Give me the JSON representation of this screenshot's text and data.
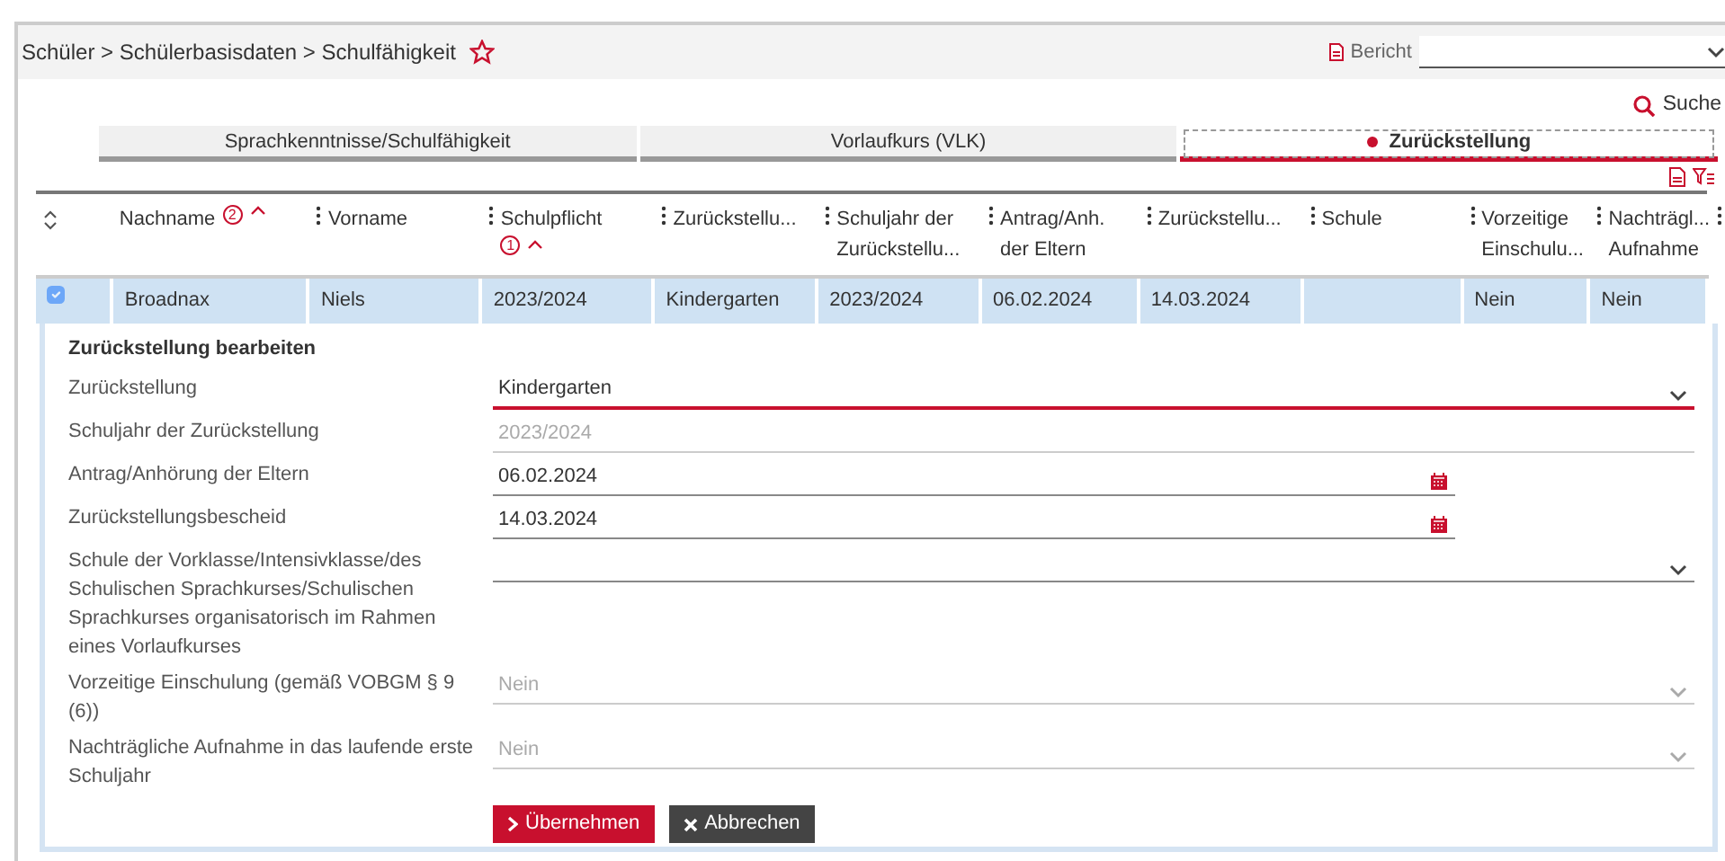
{
  "breadcrumb": {
    "path": "Schüler > Schülerbasisdaten > Schulfähigkeit"
  },
  "report": {
    "label": "Bericht"
  },
  "search": {
    "label": "Suche"
  },
  "tabs": [
    {
      "label": "Sprachkenntnisse/Schulfähigkeit",
      "selected": false
    },
    {
      "label": "Vorlaufkurs (VLK)",
      "selected": false
    },
    {
      "label": "Zurückstellung",
      "selected": true
    }
  ],
  "table": {
    "columns": [
      {
        "kind": "sort"
      },
      {
        "kind": "data",
        "label": "Nachname",
        "sort_rank": "2"
      },
      {
        "kind": "data",
        "label": "Vorname"
      },
      {
        "kind": "data",
        "label": "Schulpflicht",
        "sort_rank": "1"
      },
      {
        "kind": "data",
        "label": "Zurückstellu..."
      },
      {
        "kind": "data",
        "label": "Schuljahr der Zurückstellu..."
      },
      {
        "kind": "data",
        "label": "Antrag/Anh. der Eltern"
      },
      {
        "kind": "data",
        "label": "Zurückstellu..."
      },
      {
        "kind": "data",
        "label": "Schule"
      },
      {
        "kind": "data",
        "label": "Vorzeitige Einschulu..."
      },
      {
        "kind": "data",
        "label": "Nachträgl... Aufnahme"
      }
    ],
    "rows": [
      {
        "selected": true,
        "cells": [
          "",
          "Broadnax",
          "Niels",
          "2023/2024",
          "Kindergarten",
          "2023/2024",
          "06.02.2024",
          "14.03.2024",
          "",
          "Nein",
          "Nein"
        ]
      }
    ]
  },
  "form": {
    "title": "Zurückstellung bearbeiten",
    "fields": [
      {
        "label": "Zurückstellung",
        "kind": "select",
        "value": "Kindergarten",
        "disabled": false,
        "active": true
      },
      {
        "label": "Schuljahr der Zurückstellung",
        "kind": "text",
        "value": "2023/2024",
        "disabled": true,
        "active": false
      },
      {
        "label": "Antrag/Anhörung der Eltern",
        "kind": "date",
        "value": "06.02.2024",
        "disabled": false,
        "active": false
      },
      {
        "label": "Zurückstellungsbescheid",
        "kind": "date",
        "value": "14.03.2024",
        "disabled": false,
        "active": false
      },
      {
        "label": "Schule der Vorklasse/Intensivklasse/des Schulischen Sprachkurses/Schulischen Sprachkurses organisatorisch im Rahmen eines Vorlaufkurses",
        "kind": "select",
        "disabled": false,
        "active": false
      },
      {
        "label": "Vorzeitige Einschulung (gemäß VOBGM § 9 (6))",
        "kind": "select",
        "value": "Nein",
        "disabled": true,
        "active": false
      },
      {
        "label": "Nachträgliche Aufnahme in das laufende erste Schuljahr",
        "kind": "select",
        "value": "Nein",
        "disabled": true,
        "active": false
      }
    ],
    "buttons": [
      {
        "label": "Übernehmen",
        "kind": "primary"
      },
      {
        "label": "Abbrechen",
        "kind": "secondary"
      }
    ]
  }
}
